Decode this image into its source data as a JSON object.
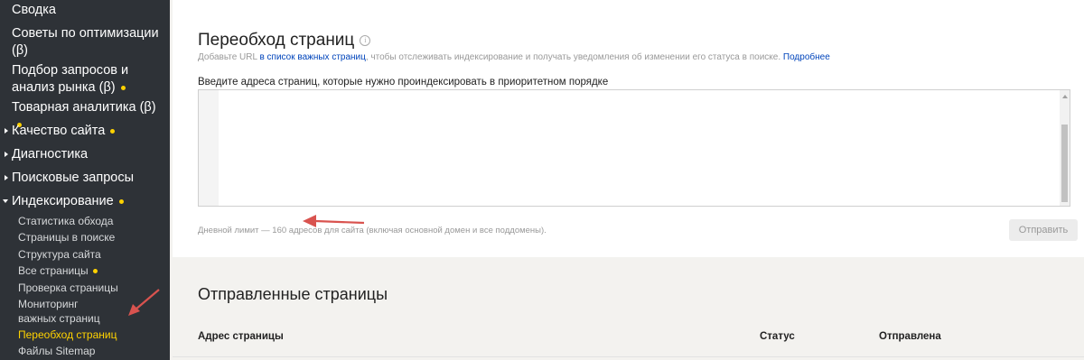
{
  "sidebar": {
    "top_items": [
      {
        "label": "Сводка"
      },
      {
        "label": "Советы по оптимизации (β)"
      },
      {
        "label": "Подбор запросов и анализ рынка (β)"
      },
      {
        "label": "Товарная аналитика (β)"
      },
      {
        "label": "Качество сайта"
      },
      {
        "label": "Диагностика"
      },
      {
        "label": "Поисковые запросы"
      },
      {
        "label": "Индексирование"
      }
    ],
    "sub_items": [
      {
        "label": "Статистика обхода"
      },
      {
        "label": "Страницы в поиске"
      },
      {
        "label": "Структура сайта"
      },
      {
        "label": "Все страницы"
      },
      {
        "label": "Проверка страницы"
      },
      {
        "label": "Мониторинг важных страниц"
      },
      {
        "label": "Переобход страниц"
      },
      {
        "label": "Файлы Sitemap"
      }
    ]
  },
  "main": {
    "title": "Переобход страниц",
    "description": {
      "prefix": "Добавьте URL ",
      "link": "в список важных страниц",
      "middle": ", чтобы отслеживать индексирование и получать уведомления об изменении его статуса в поиске. ",
      "more": "Подробнее"
    },
    "textarea_label": "Введите адреса страниц, которые нужно проиндексировать в приоритетном порядке",
    "textarea_value": "",
    "limit_text": "Дневной лимит — 160 адресов для сайта (включая основной домен и все поддомены).",
    "submit_label": "Отправить"
  },
  "sent": {
    "title": "Отправленные страницы",
    "columns": [
      "Адрес страницы",
      "Статус",
      "Отправлена"
    ]
  },
  "colors": {
    "sidebar_bg": "#2e3237",
    "accent": "#ffd200",
    "link": "#0044bb",
    "arrow": "#d9534f"
  }
}
